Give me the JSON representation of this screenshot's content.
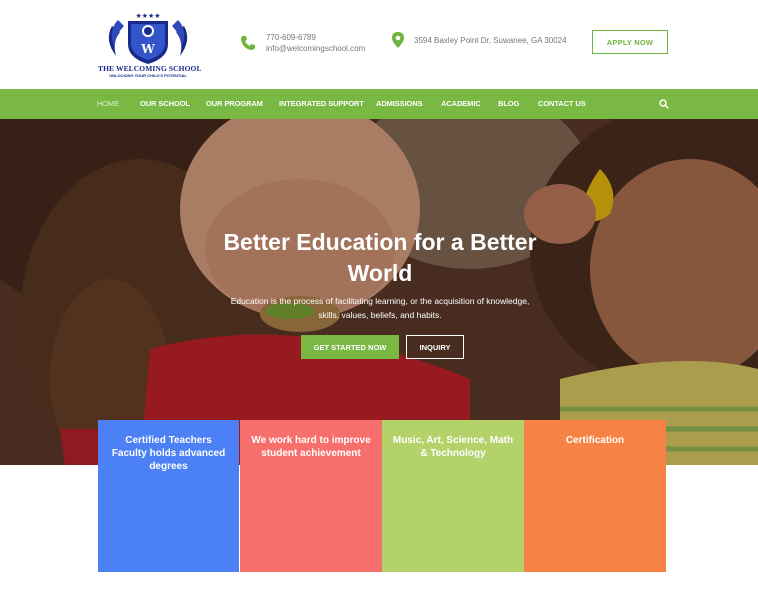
{
  "header": {
    "logo": {
      "name": "THE WELCOMING SCHOOL",
      "tagline": "UNLOCKING YOUR CHILD'S POTENTIAL",
      "icon": "shield-crest-logo"
    },
    "phone": "770-609-6789",
    "email": "info@welcomingschool.com",
    "address": "3594 Baxley Point Dr, Suwanee, GA 30024",
    "apply_label": "APPLY NOW"
  },
  "nav": {
    "items": [
      {
        "label": "HOME",
        "active": true
      },
      {
        "label": "OUR SCHOOL"
      },
      {
        "label": "OUR PROGRAM"
      },
      {
        "label": "INTEGRATED SUPPORT"
      },
      {
        "label": "ADMISSIONS"
      },
      {
        "label": "ACADEMIC"
      },
      {
        "label": "BLOG"
      },
      {
        "label": "CONTACT US"
      }
    ],
    "search_icon": "search-icon"
  },
  "hero": {
    "title_line1": "Better Education for a Better",
    "title_line2": "World",
    "desc_line1": "Education is the process of facilitating learning, or the acquisition of knowledge,",
    "desc_line2": "skills, values, beliefs, and habits.",
    "primary_button": "GET STARTED NOW",
    "secondary_button": "INQUIRY"
  },
  "features": [
    {
      "text": "Certified Teachers Faculty holds advanced degrees",
      "color": "#4c80f5"
    },
    {
      "text": "We work hard to improve student achievement",
      "color": "#f76f6d"
    },
    {
      "text": "Music, Art, Science, Math & Technology",
      "color": "#b3d36a"
    },
    {
      "text": "Certification",
      "color": "#f68345"
    }
  ],
  "colors": {
    "brand_green": "#78b843",
    "logo_blue": "#1a2a8a"
  }
}
